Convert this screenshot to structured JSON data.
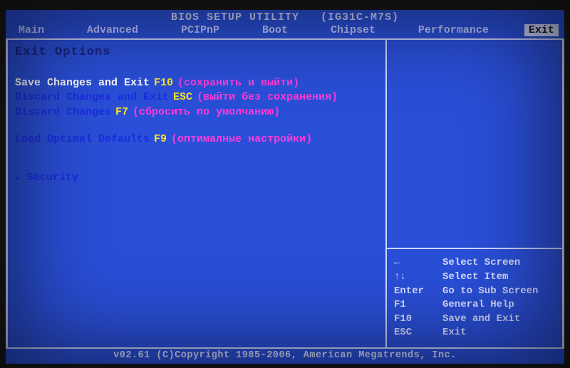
{
  "header": {
    "title": "BIOS SETUP UTILITY",
    "board": "(IG31C-M7S)"
  },
  "tabs": [
    "Main",
    "Advanced",
    "PCIPnP",
    "Boot",
    "Chipset",
    "Performance",
    "Exit"
  ],
  "active_tab": "Exit",
  "section_title": "Exit Options",
  "options": [
    {
      "label": "Save Changes and Exit",
      "key": "F10",
      "hint": "(сохранить и выйти)",
      "selected": true
    },
    {
      "label": "Discard Changes and Exit",
      "key": "ESC",
      "hint": "(выйти без сохранения)",
      "selected": false
    },
    {
      "label": "Discard Changes",
      "key": "F7",
      "hint": "(сбросить по умолчанию)",
      "selected": false
    }
  ],
  "option_after_gap": {
    "label": "Load Optimal Defaults",
    "key": "F9",
    "hint": "(оптималные настройки)",
    "selected": false
  },
  "submenu": {
    "arrow": "▸",
    "label": "Security"
  },
  "help": [
    {
      "key": "←",
      "desc": "Select Screen"
    },
    {
      "key": "↑↓",
      "desc": "Select Item"
    },
    {
      "key": "Enter",
      "desc": "Go to Sub Screen"
    },
    {
      "key": "F1",
      "desc": "General Help"
    },
    {
      "key": "F10",
      "desc": "Save and Exit"
    },
    {
      "key": "ESC",
      "desc": "Exit"
    }
  ],
  "footer": "v02.61 (C)Copyright 1985-2006, American Megatrends, Inc."
}
